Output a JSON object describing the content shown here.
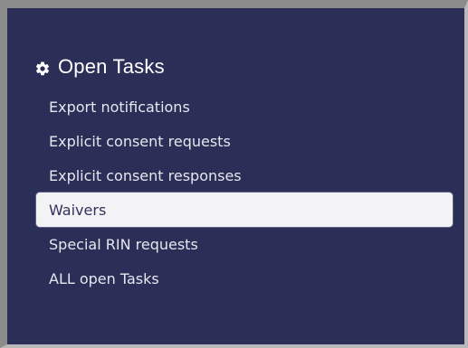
{
  "panel": {
    "title": "Open Tasks",
    "title_icon": "gear-icon",
    "items": [
      {
        "label": "Export notifications"
      },
      {
        "label": "Explicit consent requests"
      },
      {
        "label": "Explicit consent responses"
      },
      {
        "label": "Waivers",
        "selected": true
      },
      {
        "label": "Special RIN requests"
      },
      {
        "label": "ALL open Tasks"
      }
    ]
  },
  "colors": {
    "background": "#2b2f58",
    "text": "#e6e7ee",
    "selected_bg": "#f3f3f5",
    "selected_text": "#30325c",
    "frame": "#8c8c8c"
  }
}
